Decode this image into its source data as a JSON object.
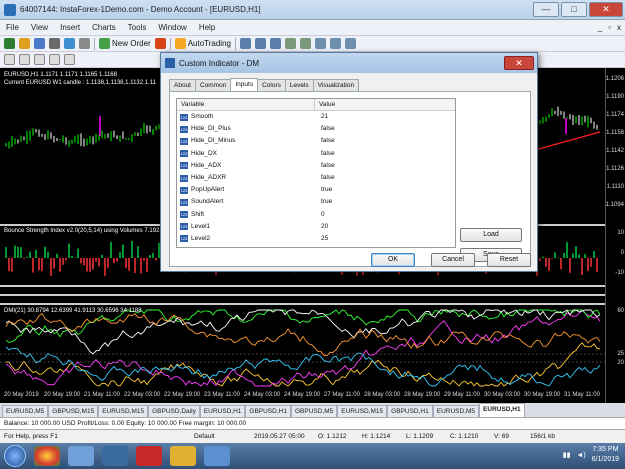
{
  "window": {
    "title": "64007144: InstaForex-1Demo.com - Demo Account - [EURUSD,H1]",
    "controls": [
      "—",
      "□",
      "✕"
    ]
  },
  "menu": [
    "File",
    "View",
    "Insert",
    "Charts",
    "Tools",
    "Window",
    "Help"
  ],
  "toolbar": {
    "new_order": "New Order",
    "autotrading": "AutoTrading"
  },
  "chart": {
    "symbol_line": "EURUSD,H1  1.1171 1.1171 1.1165 1.1168",
    "candle_line": "Current EURUSD W1 candle : 1.1138,1.1138,1.1132,1.11",
    "bsi_label": "Bounce Strength Index v2.0(20,5,14) using Volumes 7.192",
    "dmi_label": "DMI(21) 30.8794 12.6399 41.9113 30.6596 34.1188",
    "price_ticks": [
      "1.1206",
      "1.1190",
      "1.1174",
      "1.1158",
      "1.1142",
      "1.1126",
      "1.1110",
      "1.1094"
    ],
    "bsi_ticks": [
      "10",
      "0",
      "-10"
    ],
    "dmi_ticks": [
      "60",
      "25",
      "20"
    ],
    "dates": [
      "20 May 2019",
      "20 May 19:00",
      "21 May 11:00",
      "22 May 03:00",
      "22 May 19:00",
      "23 May 11:00",
      "24 May 03:00",
      "24 May 19:00",
      "27 May 11:00",
      "28 May 03:00",
      "28 May 19:00",
      "29 May 11:00",
      "30 May 03:00",
      "30 May 19:00",
      "31 May 11:00"
    ]
  },
  "tabs": [
    "EURUSD,M5",
    "GBPUSD,M15",
    "EURUSD,M15",
    "GBPUSD,Daily",
    "EURUSD,H1",
    "GBPUSD,H1",
    "GBPUSD,M5",
    "EURUSD,M15",
    "GBPUSD,H1",
    "EURUSD,M5",
    "EURUSD,H1"
  ],
  "active_tab_index": 10,
  "balance": "Balance: 10 000.00 USD  Profit/Loss: 0.00  Equity: 10 000.00  Free margin: 10 000.00",
  "status": {
    "help": "For Help, press F1",
    "profile": "Default",
    "datetime": "2019.05.27 05:00",
    "open": "O: 1.1212",
    "high": "H: 1.1214",
    "low": "L: 1.1209",
    "close": "C: 1.1210",
    "volume": "V: 69",
    "traffic": "156/1 kb"
  },
  "taskbar": {
    "time": "7:35 PM",
    "date": "6/1/2019"
  },
  "dialog": {
    "title": "Custom Indicator - DM",
    "tabs": [
      "About",
      "Common",
      "Inputs",
      "Colors",
      "Levels",
      "Visualization"
    ],
    "active_tab": "Inputs",
    "columns": [
      "Variable",
      "Value"
    ],
    "params": [
      {
        "name": "Smooth",
        "value": "21"
      },
      {
        "name": "Hide_DI_Plus",
        "value": "false"
      },
      {
        "name": "Hide_DI_Minus",
        "value": "false"
      },
      {
        "name": "Hide_DX",
        "value": "false"
      },
      {
        "name": "Hide_ADX",
        "value": "false"
      },
      {
        "name": "Hide_ADXR",
        "value": "false"
      },
      {
        "name": "PopUpAlert",
        "value": "true"
      },
      {
        "name": "SoundAlert",
        "value": "true"
      },
      {
        "name": "Shift",
        "value": "0"
      },
      {
        "name": "Level1",
        "value": "20"
      },
      {
        "name": "Level2",
        "value": "25"
      }
    ],
    "buttons": {
      "load": "Load",
      "save": "Save",
      "ok": "OK",
      "cancel": "Cancel",
      "reset": "Reset"
    }
  },
  "colors": {
    "up": "#00ff00",
    "down": "#ff0000",
    "accent": "#2a5fa8"
  }
}
